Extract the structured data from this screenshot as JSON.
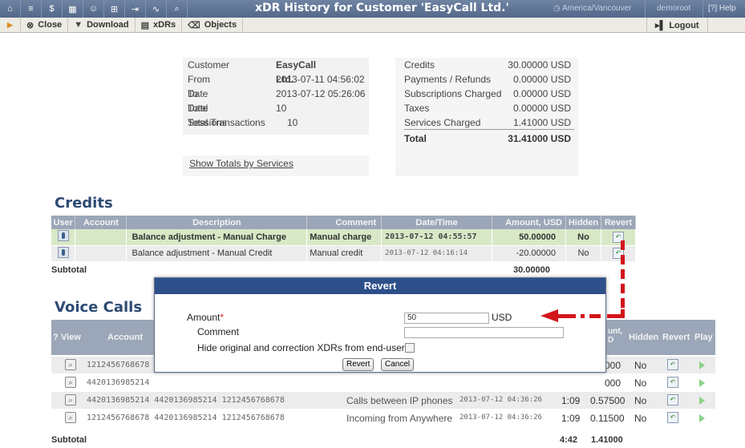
{
  "header": {
    "title": "xDR History for Customer 'EasyCall Ltd.'",
    "timezone": "America/Vancouver",
    "user": "demoroot",
    "help": "Help"
  },
  "toolbar": {
    "close": "Close",
    "download": "Download",
    "xdrs": "xDRs",
    "objects": "Objects",
    "logout": "Logout"
  },
  "summary": {
    "left": [
      {
        "label": "Customer",
        "value": "EasyCall Ltd."
      },
      {
        "label": "From Date",
        "value": "2013-07-11 04:56:02"
      },
      {
        "label": "To Date",
        "value": "2013-07-12 05:26:06"
      },
      {
        "label": "Total Sessions",
        "value": "10"
      },
      {
        "label": "Total Transactions",
        "value": "10"
      }
    ],
    "right": [
      {
        "label": "Credits",
        "value": "30.00000 USD"
      },
      {
        "label": "Payments / Refunds",
        "value": "0.00000 USD"
      },
      {
        "label": "Subscriptions Charged",
        "value": "0.00000 USD"
      },
      {
        "label": "Taxes",
        "value": "0.00000 USD"
      },
      {
        "label": "Services Charged",
        "value": "1.41000 USD"
      },
      {
        "label": "Total",
        "value": "31.41000 USD"
      }
    ],
    "totals_link": "Show Totals by Services"
  },
  "credits": {
    "heading": "Credits",
    "columns": [
      "User",
      "Account",
      "Description",
      "Comment",
      "Date/Time",
      "Amount, USD",
      "Hidden",
      "Revert"
    ],
    "rows": [
      {
        "description": "Balance adjustment - Manual Charge",
        "comment": "Manual charge",
        "datetime": "2013-07-12 04:55:57",
        "amount": "50.00000",
        "hidden": "No"
      },
      {
        "description": "Balance adjustment - Manual Credit",
        "comment": "Manual credit",
        "datetime": "2013-07-12 04:16:14",
        "amount": "-20.00000",
        "hidden": "No"
      }
    ],
    "subtotal_label": "Subtotal",
    "subtotal_value": "30.00000"
  },
  "voice": {
    "heading": "Voice Calls",
    "col_q": "?",
    "col_view": "View",
    "col_account": "Account",
    "col_amount": "unt, D",
    "col_hidden": "Hidden",
    "col_revert": "Revert",
    "col_play": "Play",
    "rows": [
      {
        "account": "1212456768678",
        "amount": "000",
        "hidden": "No"
      },
      {
        "account": "4420136985214",
        "amount": "000",
        "hidden": "No"
      },
      {
        "account": "4420136985214 4420136985214 1212456768678",
        "description": "Calls between IP phones",
        "datetime": "2013-07-12 04:36:26",
        "duration": "1:09",
        "amount": "0.57500",
        "hidden": "No"
      },
      {
        "account": "1212456768678 4420136985214 1212456768678",
        "description": "Incoming from Anywhere",
        "datetime": "2013-07-12 04:36:26",
        "duration": "1:09",
        "amount": "0.11500",
        "hidden": "No"
      }
    ],
    "subtotal_label": "Subtotal",
    "subtotal_duration": "4:42",
    "subtotal_amount": "1.41000"
  },
  "modal": {
    "title": "Revert",
    "amount_label": "Amount",
    "amount_required": "*",
    "amount_value": "50",
    "currency": "USD",
    "comment_label": "Comment",
    "comment_value": "",
    "hide_label": "Hide original and correction XDRs from end-user",
    "hide_checked": false,
    "revert_button": "Revert",
    "cancel_button": "Cancel"
  },
  "colors": {
    "header_bg": "#5e7392",
    "modal_header": "#2d4f8a",
    "highlight_row": "#d8e8c6",
    "annotation_arrow": "#d3161c",
    "heading_text": "#2d4a73"
  }
}
